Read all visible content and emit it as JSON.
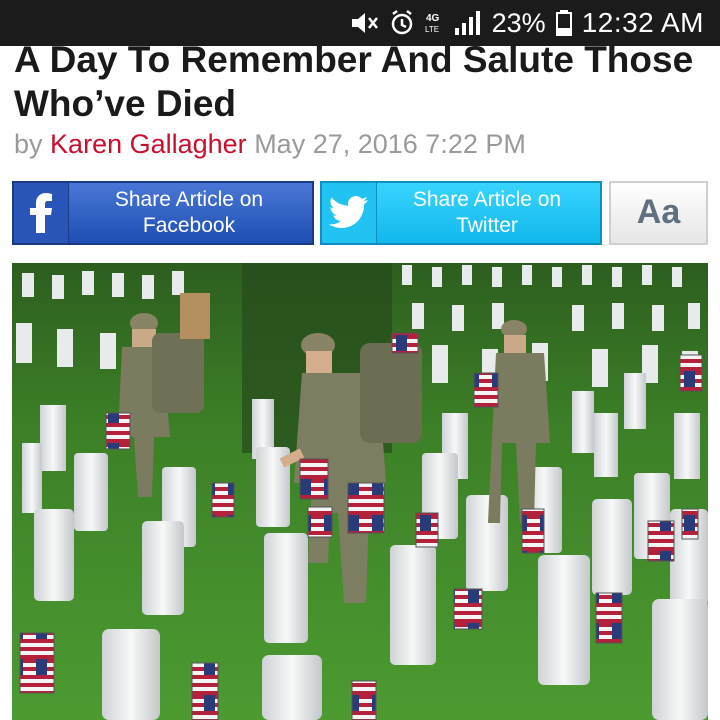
{
  "status_bar": {
    "battery": "23%",
    "time": "12:32 AM",
    "network": "4G LTE",
    "icons": [
      "mute-icon",
      "alarm-icon",
      "network-4g-icon",
      "signal-icon",
      "battery-icon"
    ]
  },
  "article": {
    "title": "A Day To Remember And Salute Those Who’ve Died",
    "by": "by",
    "author": "Karen Gallagher",
    "date": "May 27, 2016 7:22 PM"
  },
  "share": {
    "facebook": {
      "line1": "Share Article on",
      "line2": "Facebook",
      "icon": "facebook-icon"
    },
    "twitter": {
      "line1": "Share Article on",
      "line2": "Twitter",
      "icon": "twitter-icon"
    },
    "text_size": "Aa"
  },
  "photo": {
    "subject": "soldiers-placing-flags-cemetery"
  },
  "colors": {
    "statusbar": "#1b1b1b",
    "author": "#c8102e",
    "facebook": "#2a55b8",
    "twitter": "#22c2f2",
    "grass": "#3f8a2a"
  }
}
